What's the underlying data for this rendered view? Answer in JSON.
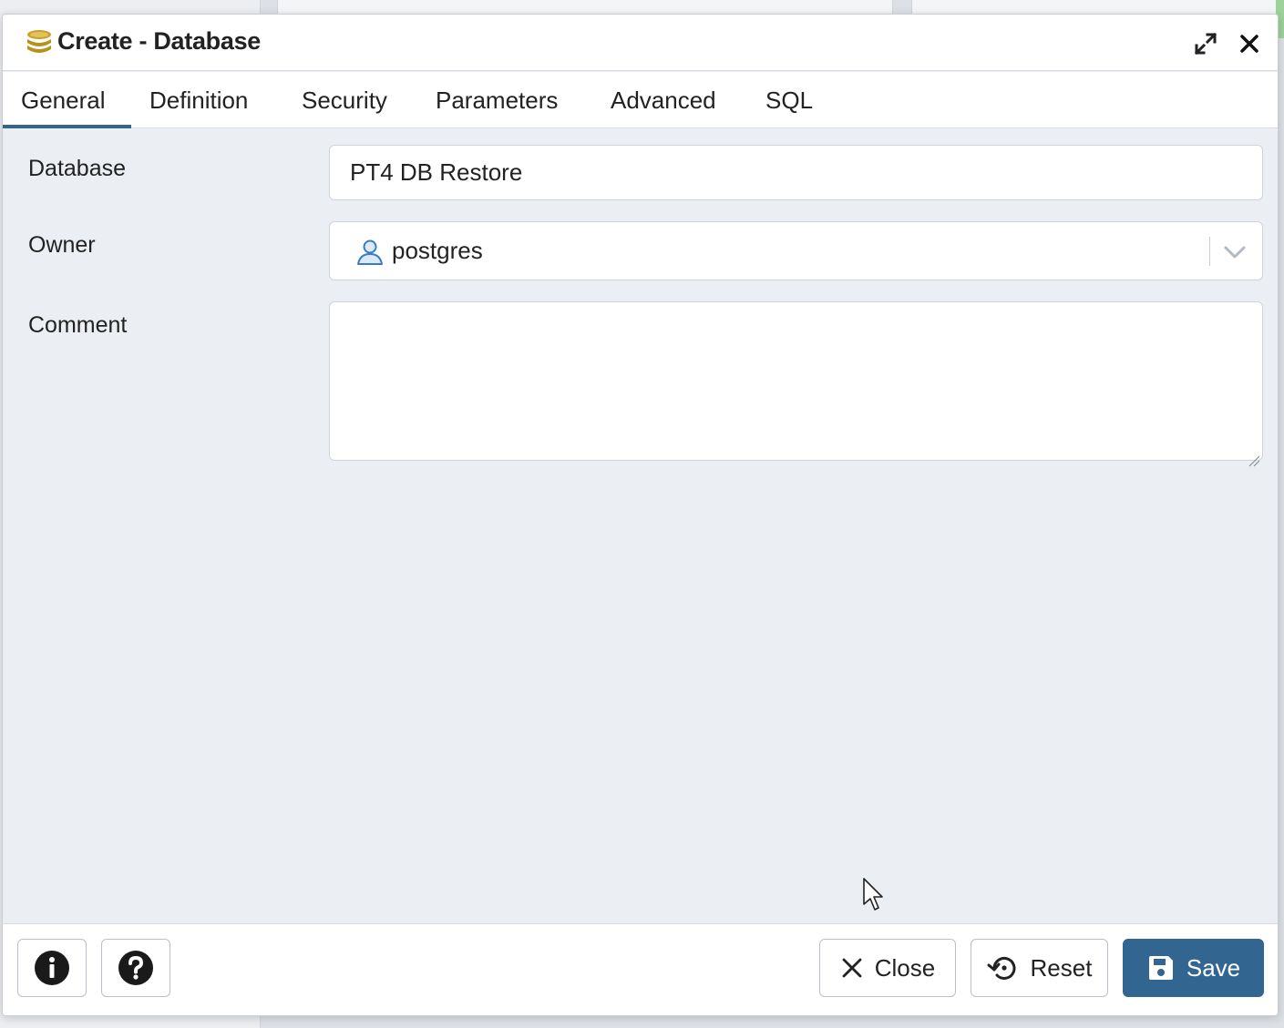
{
  "dialog": {
    "title": "Create - Database",
    "icon": "database-icon"
  },
  "tabs": [
    {
      "label": "General",
      "active": true
    },
    {
      "label": "Definition",
      "active": false
    },
    {
      "label": "Security",
      "active": false
    },
    {
      "label": "Parameters",
      "active": false
    },
    {
      "label": "Advanced",
      "active": false
    },
    {
      "label": "SQL",
      "active": false
    }
  ],
  "form": {
    "database": {
      "label": "Database",
      "value": "PT4 DB Restore"
    },
    "owner": {
      "label": "Owner",
      "value": "postgres",
      "icon": "user-icon"
    },
    "comment": {
      "label": "Comment",
      "value": ""
    }
  },
  "footer": {
    "close_label": "Close",
    "reset_label": "Reset",
    "save_label": "Save"
  },
  "colors": {
    "accent": "#326690",
    "db_icon": "#c9a227",
    "background": "#ebeef2"
  }
}
